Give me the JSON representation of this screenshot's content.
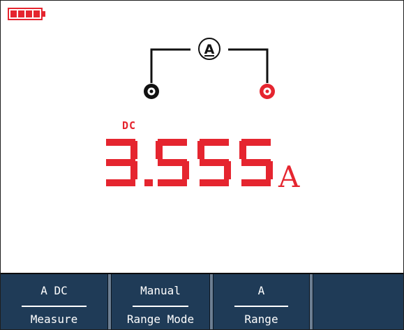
{
  "status": {
    "battery_icon": "battery-full-icon"
  },
  "diagram": {
    "meter_symbol": "A",
    "common_jack": "black-jack-icon",
    "input_jack": "red-jack-icon"
  },
  "measurement": {
    "coupling": "DC",
    "value": "3.555",
    "unit": "A"
  },
  "softkeys": [
    {
      "value": "A DC",
      "label": "Measure"
    },
    {
      "value": "Manual",
      "label": "Range Mode"
    },
    {
      "value": "A",
      "label": "Range"
    }
  ],
  "colors": {
    "reading": "#e5252f",
    "softkey_bg": "#1f3b57",
    "separator": "#6d7f93",
    "battery": "#e5252f"
  }
}
